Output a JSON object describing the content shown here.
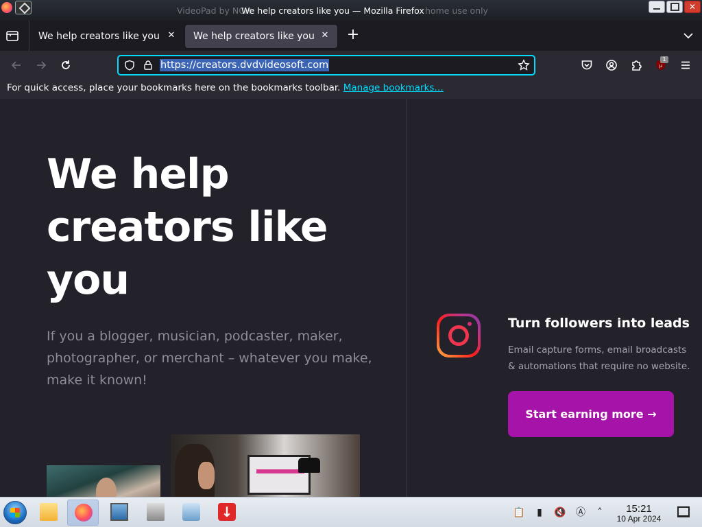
{
  "window": {
    "title": "We help creators like you — Mozilla Firefox",
    "background_title_left": "VideoPad by NCH",
    "background_title_right": "home use only"
  },
  "tabs": [
    {
      "label": "We help creators like you",
      "active": false
    },
    {
      "label": "We help creators like you",
      "active": true
    }
  ],
  "navbar": {
    "url": "https://creators.dvdvideosoft.com",
    "extension_badge": "1"
  },
  "bookmarks_bar": {
    "message": "For quick access, place your bookmarks here on the bookmarks toolbar. ",
    "link": "Manage bookmarks…"
  },
  "page": {
    "hero_title": "We help creators like you",
    "hero_subtitle": "If you a blogger, musician, podcaster, maker, photographer, or merchant – whatever you make, make it known!",
    "feature": {
      "title": "Turn followers into leads",
      "description": "Email capture forms, email broadcasts & automations that require no website.",
      "cta": "Start earning more →"
    }
  },
  "taskbar": {
    "apps": [
      "file-manager-icon",
      "firefox-icon",
      "system-monitor-icon",
      "videopad-icon",
      "computer-icon",
      "downloader-icon"
    ],
    "clock_time": "15:21",
    "clock_date": "10 Apr 2024"
  },
  "colors": {
    "accent_focus": "#00ddff",
    "cta_background": "#a513a9",
    "page_background": "#23222b"
  }
}
